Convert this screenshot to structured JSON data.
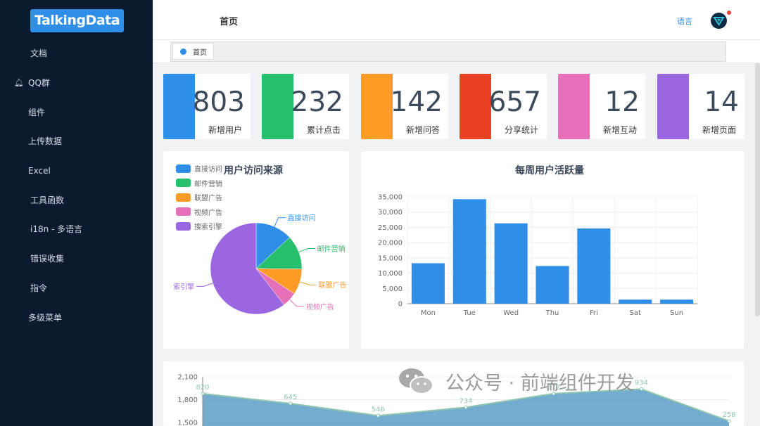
{
  "brand": "TalkingData",
  "sidebar": {
    "items": [
      {
        "label": "文档"
      },
      {
        "label": "QQ群",
        "icon": "bell-icon"
      },
      {
        "label": "组件"
      },
      {
        "label": "上传数据"
      },
      {
        "label": "Excel"
      },
      {
        "label": "工具函数"
      },
      {
        "label": "i18n - 多语言"
      },
      {
        "label": "错误收集"
      },
      {
        "label": "指令"
      },
      {
        "label": "多级菜单"
      }
    ]
  },
  "header": {
    "title": "首页",
    "lang": "语言"
  },
  "tabs": [
    {
      "label": "首页"
    }
  ],
  "stats": [
    {
      "value": "803",
      "label": "新增用户",
      "color": "#2f8fe8"
    },
    {
      "value": "232",
      "label": "累计点击",
      "color": "#26bf6b"
    },
    {
      "value": "142",
      "label": "新增问答",
      "color": "#fd9b27"
    },
    {
      "value": "657",
      "label": "分享统计",
      "color": "#ea4125"
    },
    {
      "value": "12",
      "label": "新增互动",
      "color": "#e56fb9"
    },
    {
      "value": "14",
      "label": "新增页面",
      "color": "#9b67e0"
    }
  ],
  "chart_data": [
    {
      "type": "pie",
      "title": "用户访问来源",
      "categories": [
        "直接访问",
        "邮件营销",
        "联盟广告",
        "视频广告",
        "搜索引擎"
      ],
      "values": [
        335,
        310,
        234,
        135,
        1548
      ],
      "colors": [
        "#2f8fe8",
        "#26bf6b",
        "#fd9b27",
        "#e56fb9",
        "#9b67e0"
      ],
      "slice_labels": [
        "直接访问",
        "邮件营销",
        "联盟广告",
        "视频广告",
        "索引擎"
      ],
      "legend": "top-left"
    },
    {
      "type": "bar",
      "title": "每周用户活跃量",
      "categories": [
        "Mon",
        "Tue",
        "Wed",
        "Thu",
        "Fri",
        "Sat",
        "Sun"
      ],
      "values": [
        13253,
        34235,
        26321,
        12340,
        24643,
        1322,
        1324
      ],
      "ylim": [
        0,
        35000
      ],
      "yticks": [
        "0",
        "5,000",
        "10,000",
        "15,000",
        "20,000",
        "25,000",
        "30,000",
        "35,000"
      ],
      "color": "#2f8fe8",
      "grid": true
    },
    {
      "type": "area",
      "values": [
        1880,
        1750,
        1590,
        1700,
        1880,
        1940,
        1520
      ],
      "point_labels": [
        "820",
        "645",
        "546",
        "734",
        "872",
        "934",
        "258"
      ],
      "ylim": [
        1500,
        2100
      ],
      "yticks": [
        "1,500",
        "1,800",
        "2,100"
      ],
      "color": "#5a9ec6",
      "line_color": "#91c7ae"
    }
  ],
  "watermark": "公众号 · 前端组件开发"
}
